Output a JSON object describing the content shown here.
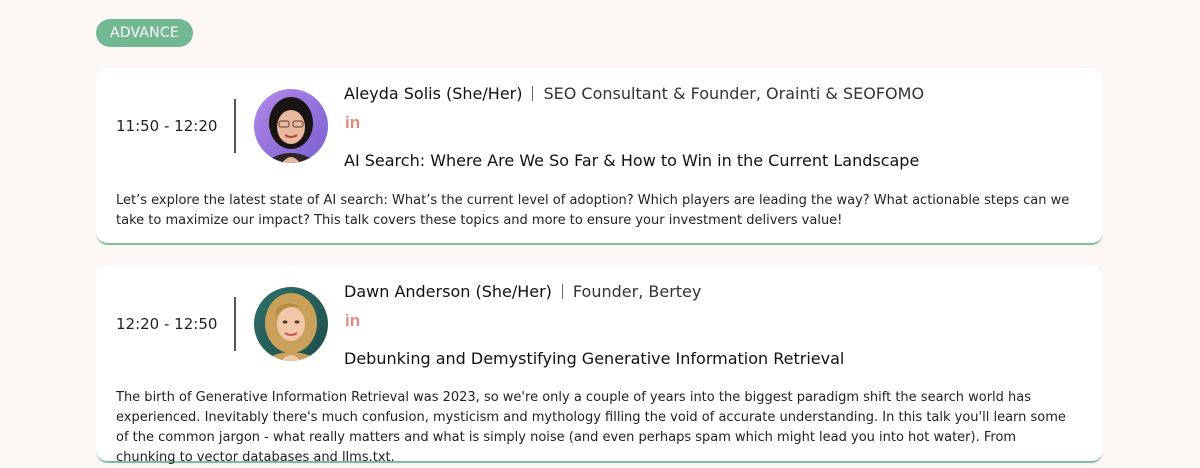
{
  "section": {
    "badge": "ADVANCE"
  },
  "sessions": [
    {
      "time": "11:50 - 12:20",
      "speaker_name": "Aleyda Solis (She/Her)",
      "speaker_role": "SEO Consultant & Founder, Orainti & SEOFOMO",
      "linkedin_label": "in",
      "talk_title": "AI Search: Where Are We So Far & How to Win in the Current Landscape",
      "description": "Let’s explore the latest state of AI search: What’s the current level of adoption? Which players are leading the way? What actionable steps can we take to maximize our impact? This talk covers these topics and more to ensure your investment delivers value!",
      "avatar_icon": "speaker-photo"
    },
    {
      "time": "12:20 - 12:50",
      "speaker_name": "Dawn Anderson (She/Her)",
      "speaker_role": "Founder, Bertey",
      "linkedin_label": "in",
      "talk_title": "Debunking and Demystifying Generative Information Retrieval",
      "description": "The birth of Generative Information Retrieval was 2023, so we're only a couple of years into the biggest paradigm shift the search world has experienced. Inevitably there's much confusion, mysticism and mythology filling the void of accurate understanding. In this talk you'll learn some of the common jargon - what really matters and what is simply noise (and even perhaps spam which might lead you into hot water). From chunking to vector databases and llms.txt.",
      "avatar_icon": "speaker-photo"
    }
  ],
  "colors": {
    "badge_bg": "#72b893",
    "card_accent": "#7dbf99",
    "linkedin": "#e2897f",
    "page_bg": "#fdf7f6"
  }
}
